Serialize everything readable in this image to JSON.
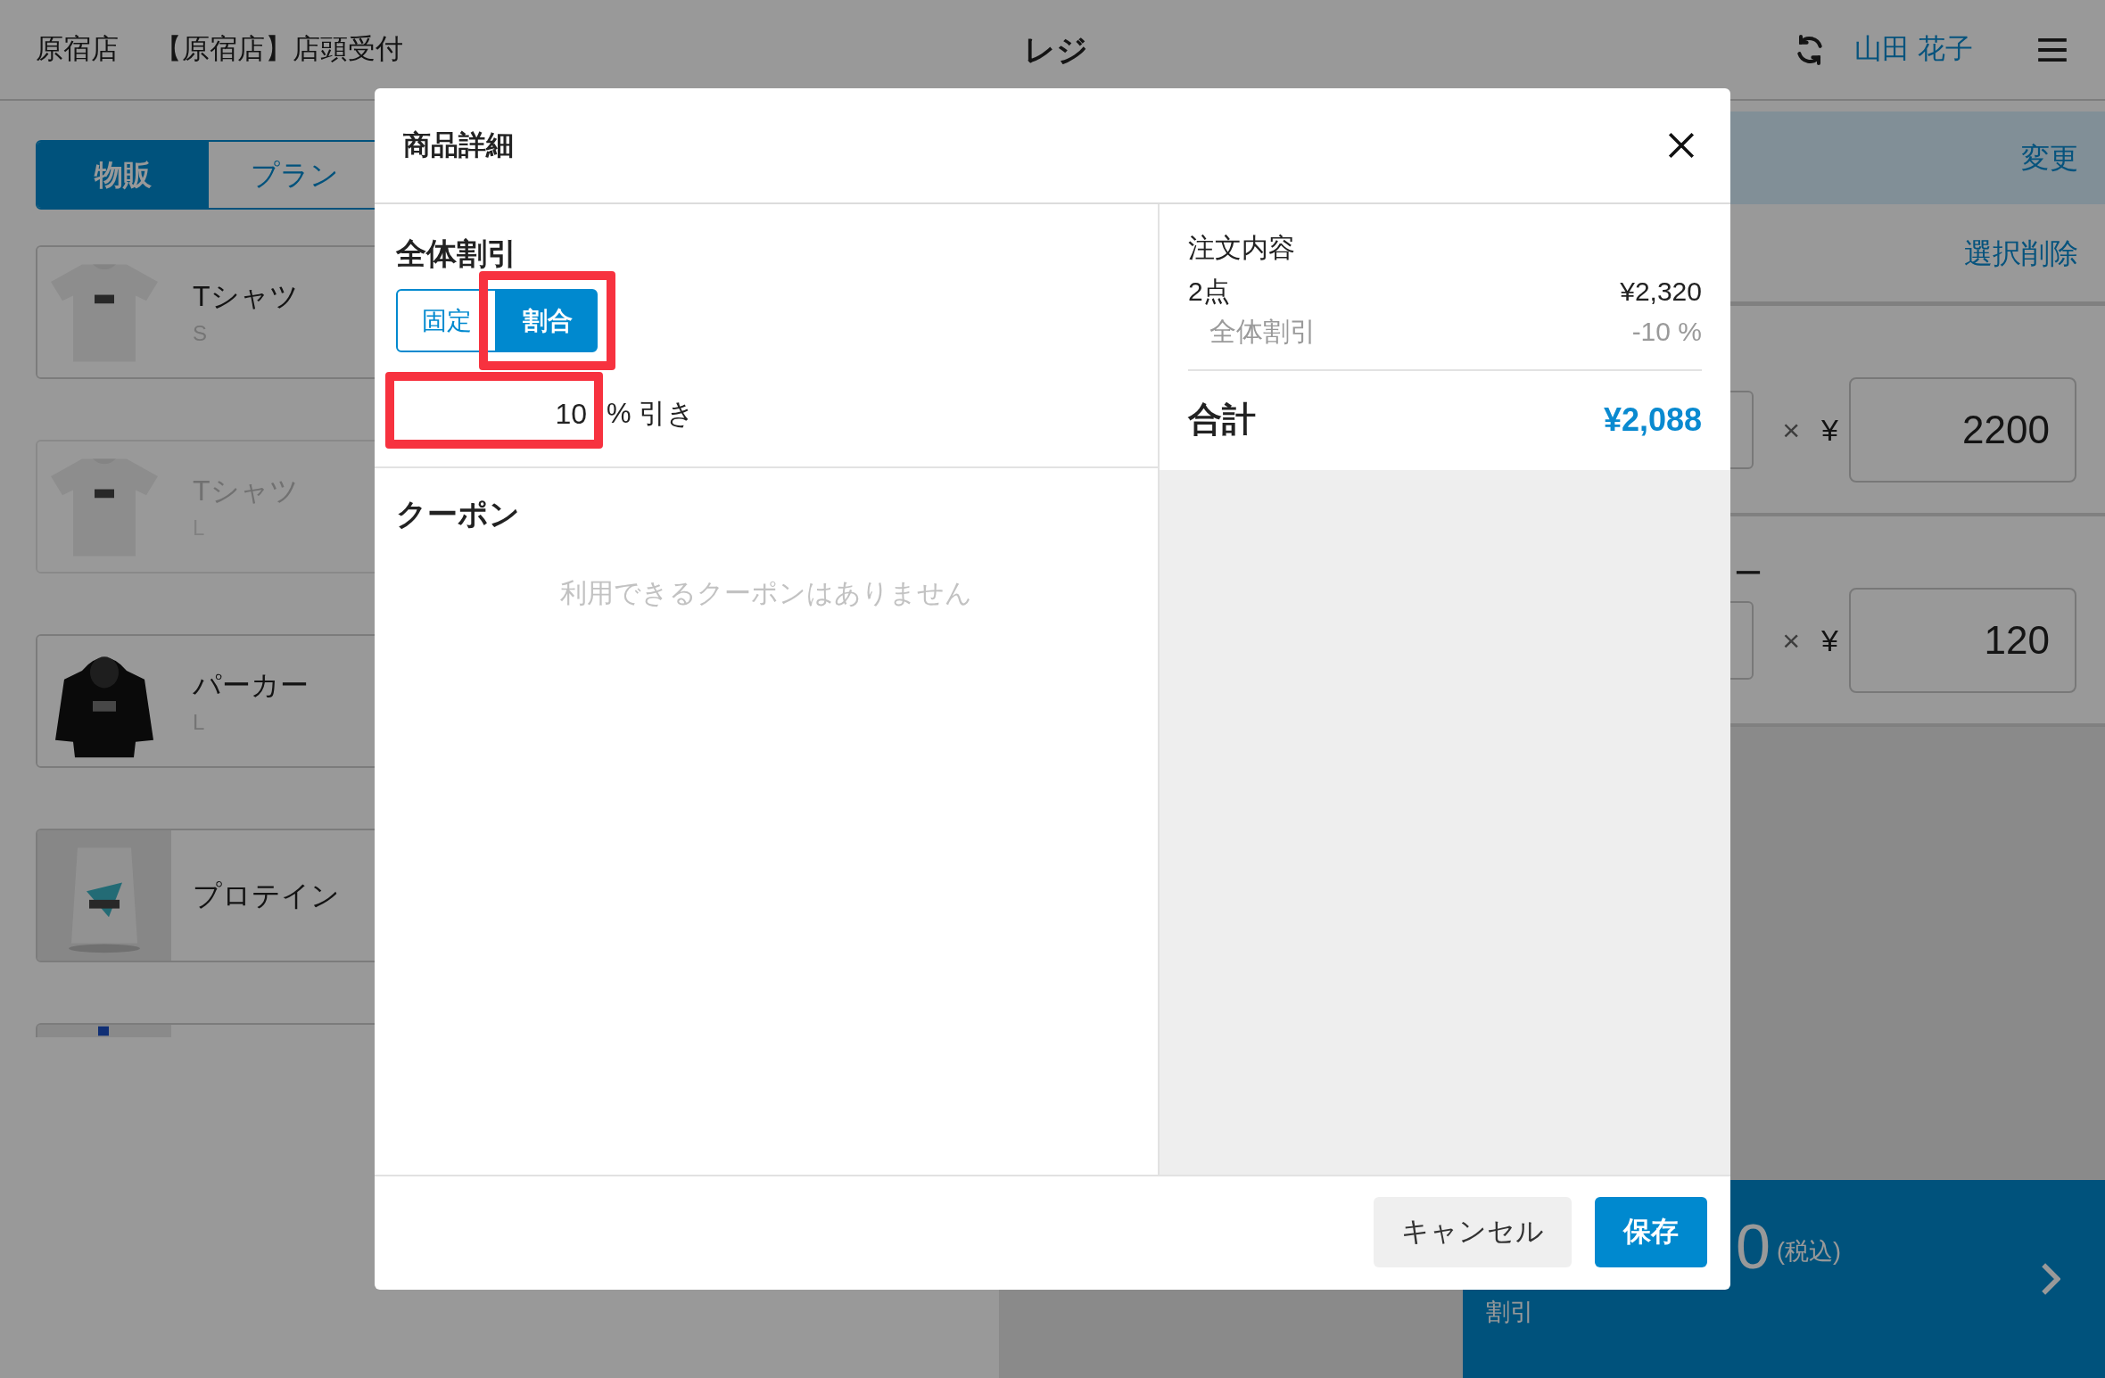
{
  "header": {
    "store": "原宿店",
    "register": "【原宿店】店頭受付",
    "title": "レジ",
    "user": "山田 花子"
  },
  "catalog": {
    "tabs": [
      {
        "label": "物販",
        "selected": true
      },
      {
        "label": "プラン",
        "selected": false
      }
    ],
    "products": [
      {
        "name": "Tシャツ",
        "variant": "S",
        "disabled": false
      },
      {
        "name": "Tシャツ",
        "variant": "L",
        "disabled": true
      },
      {
        "name": "パーカー",
        "variant": "L",
        "disabled": false
      },
      {
        "name": "プロテイン",
        "disabled": false
      }
    ]
  },
  "cart": {
    "change_link": "変更",
    "delete_selected": "選択削除",
    "lines": [
      {
        "times": "×",
        "currency": "¥",
        "price": "2200"
      },
      {
        "name": "ー",
        "times": "×",
        "currency": "¥",
        "price": "120"
      }
    ]
  },
  "checkout": {
    "amount": "0",
    "tax_note": "(税込)",
    "discount_label": "割引"
  },
  "modal": {
    "title": "商品詳細",
    "discount": {
      "heading": "全体割引",
      "modes": [
        {
          "label": "固定",
          "selected": false,
          "highlighted": false
        },
        {
          "label": "割合",
          "selected": true,
          "highlighted": true
        }
      ],
      "value": "10",
      "value_highlighted": true,
      "unit": "% 引き"
    },
    "coupon": {
      "heading": "クーポン",
      "empty": "利用できるクーポンはありません"
    },
    "summary": {
      "heading": "注文内容",
      "count": "2点",
      "subtotal": "¥2,320",
      "discount_label": "全体割引",
      "discount_value": "-10 %",
      "total_label": "合計",
      "total": "¥2,088"
    },
    "buttons": {
      "cancel": "キャンセル",
      "save": "保存"
    }
  }
}
